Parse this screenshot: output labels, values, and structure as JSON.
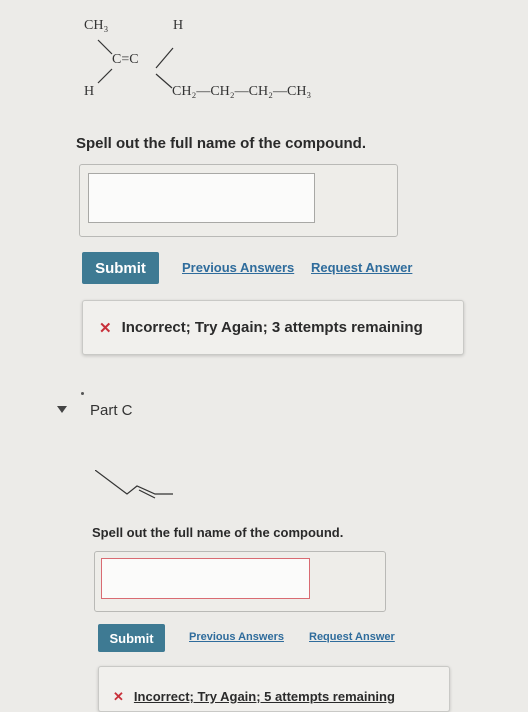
{
  "part_b": {
    "structure": {
      "ch3": "CH₃",
      "h_top": "H",
      "h_left": "H",
      "alkene": "C=C",
      "chain": "CH₂—CH₂—CH₂—CH₃"
    },
    "question": "Spell out the full name of the compound.",
    "answer_value": "",
    "submit_label": "Submit",
    "previous_answers_label": "Previous Answers",
    "request_answer_label": "Request Answer",
    "feedback_icon": "x-mark-icon",
    "feedback_text": "Incorrect; Try Again; 3 attempts remaining"
  },
  "part_c": {
    "title": "Part C",
    "question": "Spell out the full name of the compound.",
    "answer_value": "",
    "submit_label": "Submit",
    "previous_answers_label": "Previous Answers",
    "request_answer_label": "Request Answer",
    "feedback_icon": "x-mark-icon",
    "feedback_text": "Incorrect; Try Again; 5 attempts remaining"
  },
  "colors": {
    "submit_bg": "#3e7a93",
    "link": "#2f6c9c",
    "error_x": "#c8303a",
    "input_error_border": "#d96b72"
  }
}
